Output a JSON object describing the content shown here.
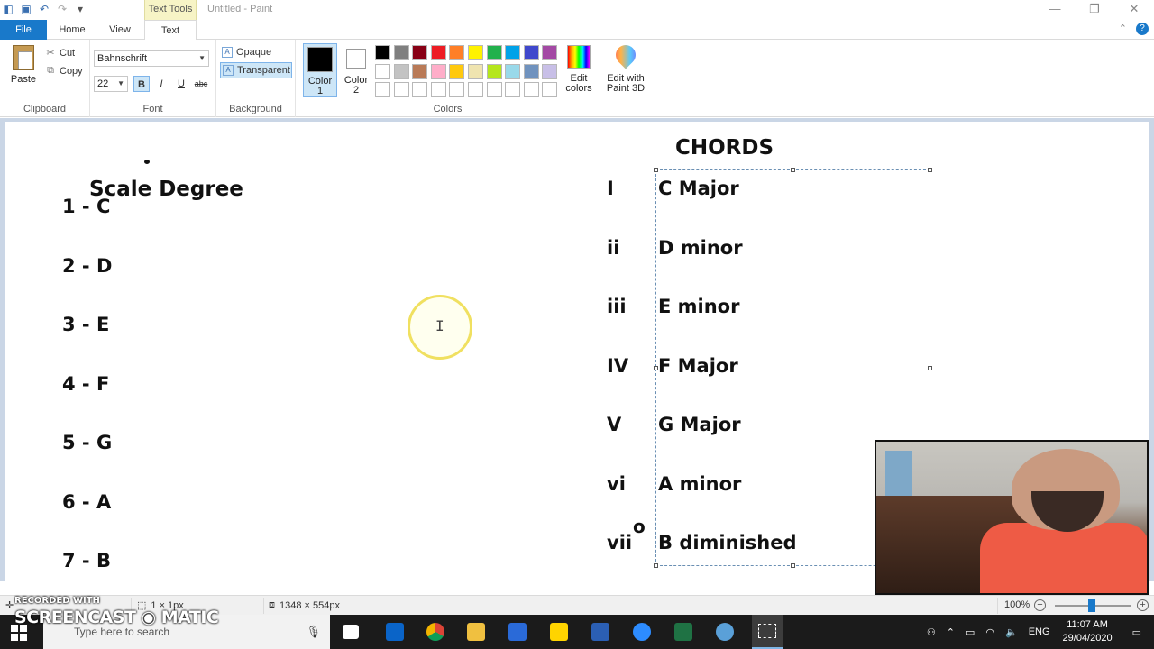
{
  "window": {
    "contextual_tab_group": "Text Tools",
    "title": "Untitled - Paint",
    "min_glyph": "—",
    "restore_glyph": "❐",
    "close_glyph": "✕"
  },
  "tabs": [
    {
      "label": "File"
    },
    {
      "label": "Home"
    },
    {
      "label": "View"
    },
    {
      "label": "Text"
    }
  ],
  "ribbon": {
    "clipboard": {
      "label": "Clipboard",
      "paste": "Paste",
      "cut": "Cut",
      "copy": "Copy"
    },
    "font": {
      "label": "Font",
      "family": "Bahnschrift",
      "size": "22",
      "bold": "B",
      "italic": "I",
      "underline": "U",
      "strike": "abc"
    },
    "background": {
      "label": "Background",
      "opaque": "Opaque",
      "transparent": "Transparent"
    },
    "colors": {
      "label": "Colors",
      "color1": "Color 1",
      "color2": "Color 2",
      "edit": "Edit colors",
      "palette": [
        "#000000",
        "#7f7f7f",
        "#880015",
        "#ed1c24",
        "#ff7f27",
        "#fff200",
        "#22b14c",
        "#00a2e8",
        "#3f48cc",
        "#a349a4",
        "#ffffff",
        "#c3c3c3",
        "#b97a57",
        "#ffaec9",
        "#ffc90e",
        "#efe4b0",
        "#b5e61d",
        "#99d9ea",
        "#7092be",
        "#c8bfe7",
        "#ffffff",
        "#ffffff",
        "#ffffff",
        "#ffffff",
        "#ffffff",
        "#ffffff",
        "#ffffff",
        "#ffffff",
        "#ffffff",
        "#ffffff"
      ]
    },
    "paint3d": {
      "label": "Edit with Paint 3D"
    }
  },
  "canvas": {
    "scale_title": "Scale Degree",
    "degrees": [
      "1 - C",
      "2 - D",
      "3 - E",
      "4 - F",
      "5 - G",
      "6 - A",
      "7 - B"
    ],
    "chords_title": "CHORDS",
    "chords": [
      {
        "roman": "I",
        "name": "C Major"
      },
      {
        "roman": "ii",
        "name": "D minor"
      },
      {
        "roman": "iii",
        "name": "E minor"
      },
      {
        "roman": "IV",
        "name": "F Major"
      },
      {
        "roman": "V",
        "name": "G Major"
      },
      {
        "roman": "vi",
        "name": "A minor"
      },
      {
        "roman": "vii",
        "name": "B diminished"
      }
    ],
    "dim_symbol": "o"
  },
  "status": {
    "cursor_pos": "",
    "selection": "1 × 1px",
    "canvas_size": "1348 × 554px",
    "zoom": "100%"
  },
  "taskbar": {
    "search_placeholder": "Type here to search",
    "lang": "ENG",
    "time": "11:07 AM",
    "date": "29/04/2020"
  },
  "watermark": {
    "line1": "RECORDED WITH",
    "line2": "SCREENCAST ◉ MATIC"
  }
}
